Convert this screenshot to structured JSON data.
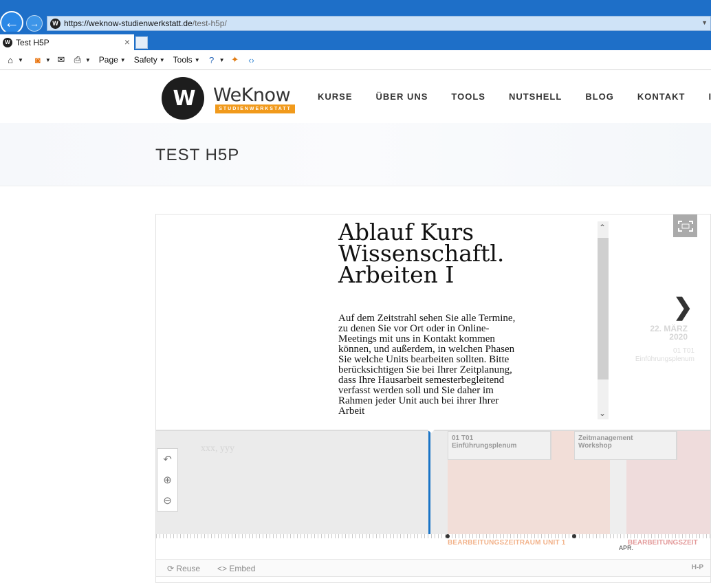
{
  "browser": {
    "url_host": "https://weknow-studienwerkstatt.de",
    "url_path": "/test-h5p/",
    "tab_title": "Test H5P",
    "site_icon_letter": "W",
    "commands": [
      "Page",
      "Safety",
      "Tools"
    ]
  },
  "site": {
    "logo_word": "WeKnow",
    "logo_sub": "STUDIENWERKSTATT",
    "nav": [
      "KURSE",
      "ÜBER UNS",
      "TOOLS",
      "NUTSHELL",
      "BLOG",
      "KONTAKT",
      "IM"
    ],
    "page_title": "TEST H5P"
  },
  "timeline": {
    "slide_title": "Ablauf Kurs Wissenschaftl. Arbeiten I",
    "slide_text": "Auf dem Zeitstrahl sehen Sie alle Termine, zu denen Sie vor Ort oder in Online-Meetings mit uns in Kontakt kommen können, und außerdem, in welchen Phasen Sie welche Units bearbeiten sollten. Bitte berücksichtigen Sie bei Ihrer Zeitplanung, dass Ihre Hausarbeit semesterbegleitend verfasst werden soll und Sie daher im Rahmen jeder Unit auch bei ihrer Ihrer Arbeit",
    "next_date_line1": "22. MÄRZ",
    "next_date_line2": "2020",
    "next_label_line1": "01 T01",
    "next_label_line2": "Einführungsplenum",
    "nav_hint": "xxx, yyy",
    "event_1_line1": "01 T01",
    "event_1_line2": "Einführungsplenum",
    "event_2_line1": "Zeitmanagement",
    "event_2_line2": "Workshop",
    "era_label_1": "BEARBEITUNGSZEITRAUM UNIT 1",
    "era_label_2": "BEARBEITUNGSZEIT",
    "month_label": "APR.",
    "reuse_label": "Reuse",
    "embed_label": "Embed",
    "h5p_logo": "H-P",
    "colors": {
      "now_line": "#1a74c6",
      "era_1": "#f2ded8",
      "era_2": "#efdcdc",
      "era_label_1": "#f2b28a",
      "era_label_2": "#e39a9a"
    }
  }
}
